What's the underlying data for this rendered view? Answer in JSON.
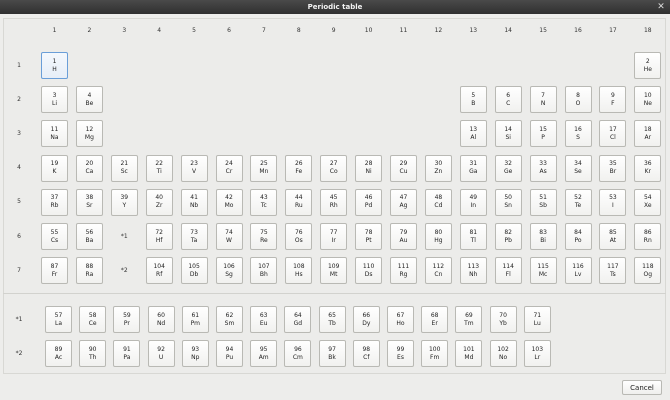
{
  "window": {
    "title": "Periodic table",
    "close_glyph": "✕"
  },
  "groups": [
    "1",
    "2",
    "3",
    "4",
    "5",
    "6",
    "7",
    "8",
    "9",
    "10",
    "11",
    "12",
    "13",
    "14",
    "15",
    "16",
    "17",
    "18"
  ],
  "periods": [
    "1",
    "2",
    "3",
    "4",
    "5",
    "6",
    "7"
  ],
  "series_labels": [
    "*1",
    "*2"
  ],
  "markers": [
    {
      "period": 6,
      "label": "*1"
    },
    {
      "period": 7,
      "label": "*2"
    }
  ],
  "selected_symbol": "H",
  "elements": [
    {
      "n": "1",
      "s": "H",
      "p": 1,
      "g": 1
    },
    {
      "n": "2",
      "s": "He",
      "p": 1,
      "g": 18
    },
    {
      "n": "3",
      "s": "Li",
      "p": 2,
      "g": 1
    },
    {
      "n": "4",
      "s": "Be",
      "p": 2,
      "g": 2
    },
    {
      "n": "5",
      "s": "B",
      "p": 2,
      "g": 13
    },
    {
      "n": "6",
      "s": "C",
      "p": 2,
      "g": 14
    },
    {
      "n": "7",
      "s": "N",
      "p": 2,
      "g": 15
    },
    {
      "n": "8",
      "s": "O",
      "p": 2,
      "g": 16
    },
    {
      "n": "9",
      "s": "F",
      "p": 2,
      "g": 17
    },
    {
      "n": "10",
      "s": "Ne",
      "p": 2,
      "g": 18
    },
    {
      "n": "11",
      "s": "Na",
      "p": 3,
      "g": 1
    },
    {
      "n": "12",
      "s": "Mg",
      "p": 3,
      "g": 2
    },
    {
      "n": "13",
      "s": "Al",
      "p": 3,
      "g": 13
    },
    {
      "n": "14",
      "s": "Si",
      "p": 3,
      "g": 14
    },
    {
      "n": "15",
      "s": "P",
      "p": 3,
      "g": 15
    },
    {
      "n": "16",
      "s": "S",
      "p": 3,
      "g": 16
    },
    {
      "n": "17",
      "s": "Cl",
      "p": 3,
      "g": 17
    },
    {
      "n": "18",
      "s": "Ar",
      "p": 3,
      "g": 18
    },
    {
      "n": "19",
      "s": "K",
      "p": 4,
      "g": 1
    },
    {
      "n": "20",
      "s": "Ca",
      "p": 4,
      "g": 2
    },
    {
      "n": "21",
      "s": "Sc",
      "p": 4,
      "g": 3
    },
    {
      "n": "22",
      "s": "Ti",
      "p": 4,
      "g": 4
    },
    {
      "n": "23",
      "s": "V",
      "p": 4,
      "g": 5
    },
    {
      "n": "24",
      "s": "Cr",
      "p": 4,
      "g": 6
    },
    {
      "n": "25",
      "s": "Mn",
      "p": 4,
      "g": 7
    },
    {
      "n": "26",
      "s": "Fe",
      "p": 4,
      "g": 8
    },
    {
      "n": "27",
      "s": "Co",
      "p": 4,
      "g": 9
    },
    {
      "n": "28",
      "s": "Ni",
      "p": 4,
      "g": 10
    },
    {
      "n": "29",
      "s": "Cu",
      "p": 4,
      "g": 11
    },
    {
      "n": "30",
      "s": "Zn",
      "p": 4,
      "g": 12
    },
    {
      "n": "31",
      "s": "Ga",
      "p": 4,
      "g": 13
    },
    {
      "n": "32",
      "s": "Ge",
      "p": 4,
      "g": 14
    },
    {
      "n": "33",
      "s": "As",
      "p": 4,
      "g": 15
    },
    {
      "n": "34",
      "s": "Se",
      "p": 4,
      "g": 16
    },
    {
      "n": "35",
      "s": "Br",
      "p": 4,
      "g": 17
    },
    {
      "n": "36",
      "s": "Kr",
      "p": 4,
      "g": 18
    },
    {
      "n": "37",
      "s": "Rb",
      "p": 5,
      "g": 1
    },
    {
      "n": "38",
      "s": "Sr",
      "p": 5,
      "g": 2
    },
    {
      "n": "39",
      "s": "Y",
      "p": 5,
      "g": 3
    },
    {
      "n": "40",
      "s": "Zr",
      "p": 5,
      "g": 4
    },
    {
      "n": "41",
      "s": "Nb",
      "p": 5,
      "g": 5
    },
    {
      "n": "42",
      "s": "Mo",
      "p": 5,
      "g": 6
    },
    {
      "n": "43",
      "s": "Tc",
      "p": 5,
      "g": 7
    },
    {
      "n": "44",
      "s": "Ru",
      "p": 5,
      "g": 8
    },
    {
      "n": "45",
      "s": "Rh",
      "p": 5,
      "g": 9
    },
    {
      "n": "46",
      "s": "Pd",
      "p": 5,
      "g": 10
    },
    {
      "n": "47",
      "s": "Ag",
      "p": 5,
      "g": 11
    },
    {
      "n": "48",
      "s": "Cd",
      "p": 5,
      "g": 12
    },
    {
      "n": "49",
      "s": "In",
      "p": 5,
      "g": 13
    },
    {
      "n": "50",
      "s": "Sn",
      "p": 5,
      "g": 14
    },
    {
      "n": "51",
      "s": "Sb",
      "p": 5,
      "g": 15
    },
    {
      "n": "52",
      "s": "Te",
      "p": 5,
      "g": 16
    },
    {
      "n": "53",
      "s": "I",
      "p": 5,
      "g": 17
    },
    {
      "n": "54",
      "s": "Xe",
      "p": 5,
      "g": 18
    },
    {
      "n": "55",
      "s": "Cs",
      "p": 6,
      "g": 1
    },
    {
      "n": "56",
      "s": "Ba",
      "p": 6,
      "g": 2
    },
    {
      "n": "72",
      "s": "Hf",
      "p": 6,
      "g": 4
    },
    {
      "n": "73",
      "s": "Ta",
      "p": 6,
      "g": 5
    },
    {
      "n": "74",
      "s": "W",
      "p": 6,
      "g": 6
    },
    {
      "n": "75",
      "s": "Re",
      "p": 6,
      "g": 7
    },
    {
      "n": "76",
      "s": "Os",
      "p": 6,
      "g": 8
    },
    {
      "n": "77",
      "s": "Ir",
      "p": 6,
      "g": 9
    },
    {
      "n": "78",
      "s": "Pt",
      "p": 6,
      "g": 10
    },
    {
      "n": "79",
      "s": "Au",
      "p": 6,
      "g": 11
    },
    {
      "n": "80",
      "s": "Hg",
      "p": 6,
      "g": 12
    },
    {
      "n": "81",
      "s": "Tl",
      "p": 6,
      "g": 13
    },
    {
      "n": "82",
      "s": "Pb",
      "p": 6,
      "g": 14
    },
    {
      "n": "83",
      "s": "Bi",
      "p": 6,
      "g": 15
    },
    {
      "n": "84",
      "s": "Po",
      "p": 6,
      "g": 16
    },
    {
      "n": "85",
      "s": "At",
      "p": 6,
      "g": 17
    },
    {
      "n": "86",
      "s": "Rn",
      "p": 6,
      "g": 18
    },
    {
      "n": "87",
      "s": "Fr",
      "p": 7,
      "g": 1
    },
    {
      "n": "88",
      "s": "Ra",
      "p": 7,
      "g": 2
    },
    {
      "n": "104",
      "s": "Rf",
      "p": 7,
      "g": 4
    },
    {
      "n": "105",
      "s": "Db",
      "p": 7,
      "g": 5
    },
    {
      "n": "106",
      "s": "Sg",
      "p": 7,
      "g": 6
    },
    {
      "n": "107",
      "s": "Bh",
      "p": 7,
      "g": 7
    },
    {
      "n": "108",
      "s": "Hs",
      "p": 7,
      "g": 8
    },
    {
      "n": "109",
      "s": "Mt",
      "p": 7,
      "g": 9
    },
    {
      "n": "110",
      "s": "Ds",
      "p": 7,
      "g": 10
    },
    {
      "n": "111",
      "s": "Rg",
      "p": 7,
      "g": 11
    },
    {
      "n": "112",
      "s": "Cn",
      "p": 7,
      "g": 12
    },
    {
      "n": "113",
      "s": "Nh",
      "p": 7,
      "g": 13
    },
    {
      "n": "114",
      "s": "Fl",
      "p": 7,
      "g": 14
    },
    {
      "n": "115",
      "s": "Mc",
      "p": 7,
      "g": 15
    },
    {
      "n": "116",
      "s": "Lv",
      "p": 7,
      "g": 16
    },
    {
      "n": "117",
      "s": "Ts",
      "p": 7,
      "g": 17
    },
    {
      "n": "118",
      "s": "Og",
      "p": 7,
      "g": 18
    }
  ],
  "lanthanides": [
    {
      "n": "57",
      "s": "La"
    },
    {
      "n": "58",
      "s": "Ce"
    },
    {
      "n": "59",
      "s": "Pr"
    },
    {
      "n": "60",
      "s": "Nd"
    },
    {
      "n": "61",
      "s": "Pm"
    },
    {
      "n": "62",
      "s": "Sm"
    },
    {
      "n": "63",
      "s": "Eu"
    },
    {
      "n": "64",
      "s": "Gd"
    },
    {
      "n": "65",
      "s": "Tb"
    },
    {
      "n": "66",
      "s": "Dy"
    },
    {
      "n": "67",
      "s": "Ho"
    },
    {
      "n": "68",
      "s": "Er"
    },
    {
      "n": "69",
      "s": "Tm"
    },
    {
      "n": "70",
      "s": "Yb"
    },
    {
      "n": "71",
      "s": "Lu"
    }
  ],
  "actinides": [
    {
      "n": "89",
      "s": "Ac"
    },
    {
      "n": "90",
      "s": "Th"
    },
    {
      "n": "91",
      "s": "Pa"
    },
    {
      "n": "92",
      "s": "U"
    },
    {
      "n": "93",
      "s": "Np"
    },
    {
      "n": "94",
      "s": "Pu"
    },
    {
      "n": "95",
      "s": "Am"
    },
    {
      "n": "96",
      "s": "Cm"
    },
    {
      "n": "97",
      "s": "Bk"
    },
    {
      "n": "98",
      "s": "Cf"
    },
    {
      "n": "99",
      "s": "Es"
    },
    {
      "n": "100",
      "s": "Fm"
    },
    {
      "n": "101",
      "s": "Md"
    },
    {
      "n": "102",
      "s": "No"
    },
    {
      "n": "103",
      "s": "Lr"
    }
  ],
  "buttons": {
    "cancel": "Cancel"
  }
}
